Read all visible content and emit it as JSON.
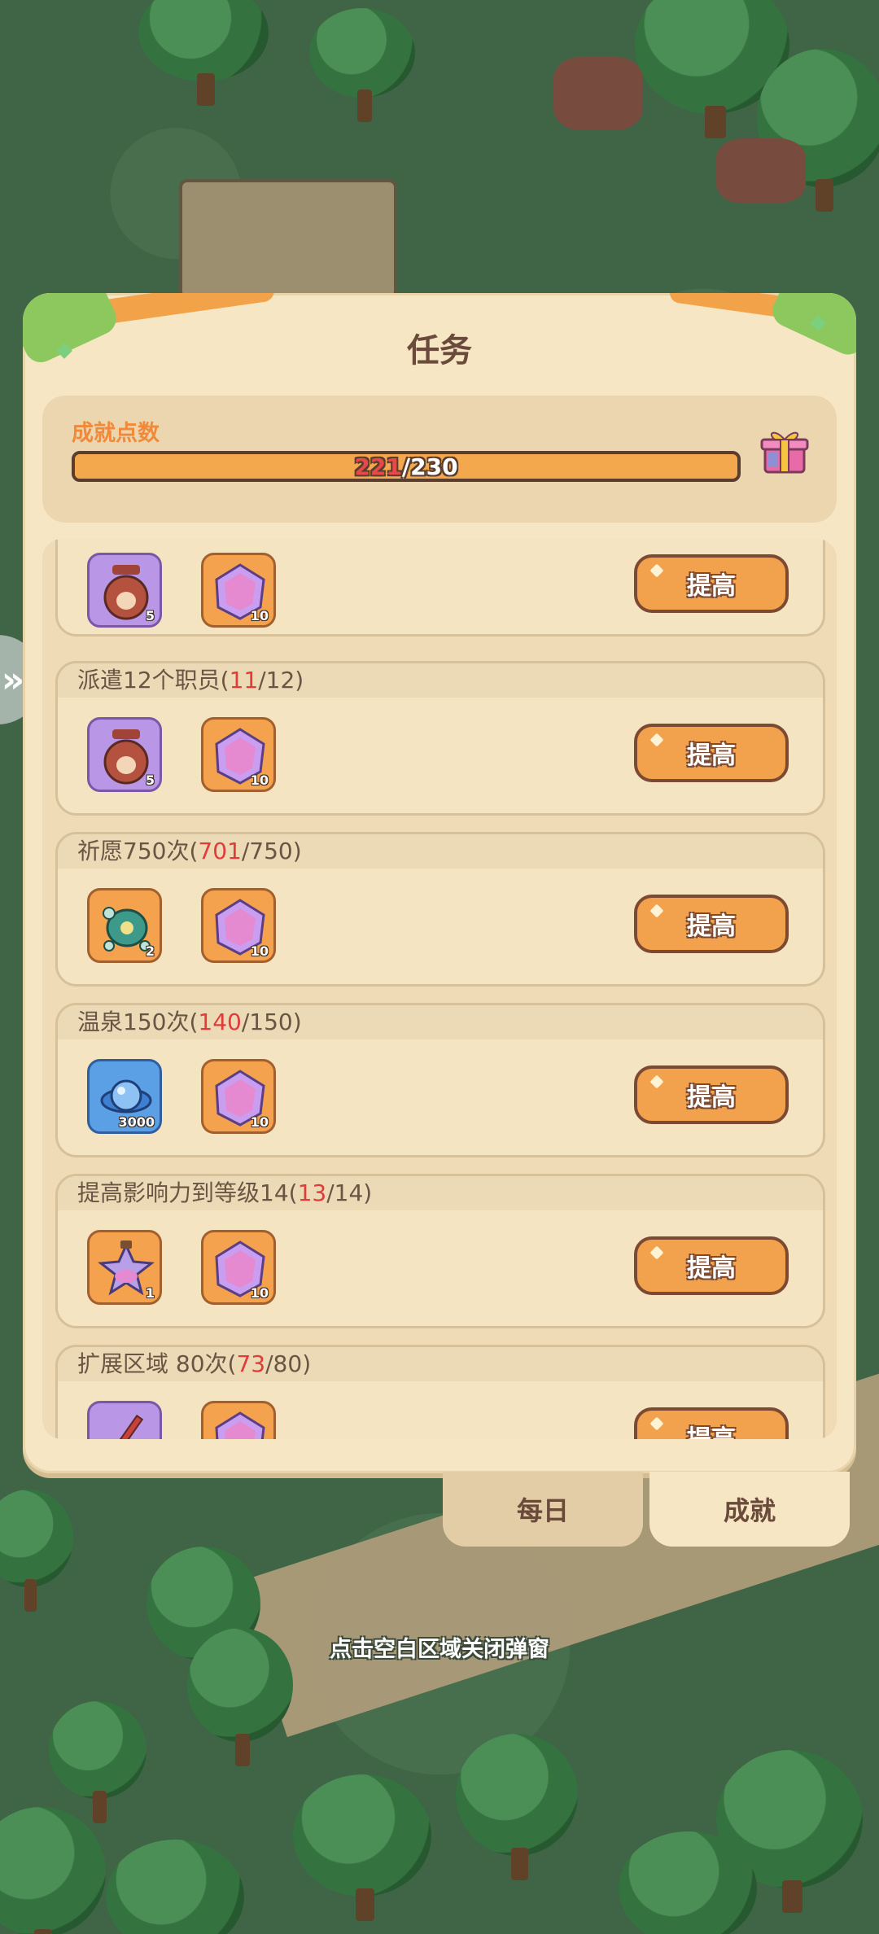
{
  "panel": {
    "title": "任务"
  },
  "points": {
    "label": "成就点数",
    "current": "221",
    "separator": "/",
    "max": "230",
    "progress_fraction": 0.96
  },
  "tasks": [
    {
      "title": "",
      "current": "",
      "total": "",
      "rewards": [
        {
          "icon": "honey-jar-icon",
          "count": "5",
          "color": "purple"
        },
        {
          "icon": "purple-crystal-icon",
          "count": "10",
          "color": "orange"
        }
      ],
      "button": "提高"
    },
    {
      "title": "派遣12个职员",
      "current": "11",
      "total": "12",
      "rewards": [
        {
          "icon": "honey-jar-icon",
          "count": "5",
          "color": "purple"
        },
        {
          "icon": "purple-crystal-icon",
          "count": "10",
          "color": "orange"
        }
      ],
      "button": "提高"
    },
    {
      "title": "祈愿750次",
      "current": "701",
      "total": "750",
      "rewards": [
        {
          "icon": "turtle-icon",
          "count": "2",
          "color": "orange"
        },
        {
          "icon": "purple-crystal-icon",
          "count": "10",
          "color": "orange"
        }
      ],
      "button": "提高"
    },
    {
      "title": "温泉150次",
      "current": "140",
      "total": "150",
      "rewards": [
        {
          "icon": "blue-orb-icon",
          "count": "3000",
          "color": "blue"
        },
        {
          "icon": "purple-crystal-icon",
          "count": "10",
          "color": "orange"
        }
      ],
      "button": "提高"
    },
    {
      "title": "提高影响力到等级14",
      "current": "13",
      "total": "14",
      "rewards": [
        {
          "icon": "potion-star-icon",
          "count": "1",
          "color": "orange"
        },
        {
          "icon": "purple-crystal-icon",
          "count": "10",
          "color": "orange"
        }
      ],
      "button": "提高"
    },
    {
      "title": "扩展区域 80次",
      "current": "73",
      "total": "80",
      "rewards": [
        {
          "icon": "shovel-icon",
          "count": "",
          "color": "purple"
        },
        {
          "icon": "purple-crystal-icon",
          "count": "",
          "color": "orange"
        }
      ],
      "button": "提高"
    }
  ],
  "tabs": {
    "daily": "每日",
    "achievement": "成就"
  },
  "close_hint": "点击空白区域关闭弹窗",
  "colors": {
    "panel_bg": "#f7e6c4",
    "accent_orange": "#f2a24c",
    "progress_red": "#e23b3b"
  }
}
